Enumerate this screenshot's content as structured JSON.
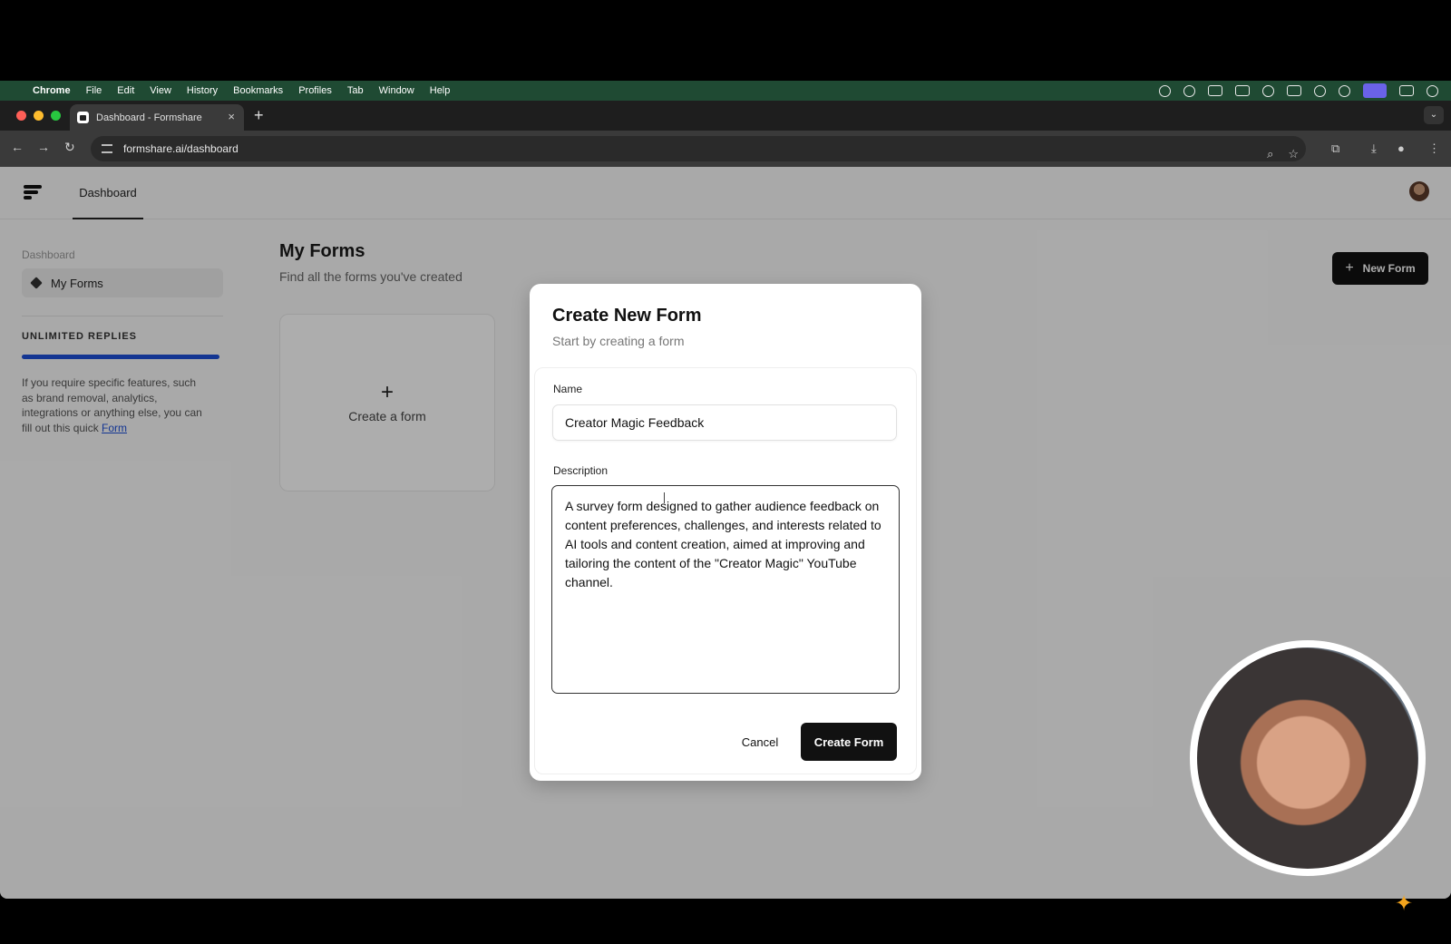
{
  "menubar": {
    "app": "Chrome",
    "items": [
      "File",
      "Edit",
      "View",
      "History",
      "Bookmarks",
      "Profiles",
      "Tab",
      "Window",
      "Help"
    ]
  },
  "browser": {
    "tab_title": "Dashboard - Formshare",
    "url": "formshare.ai/dashboard"
  },
  "header": {
    "nav_tab": "Dashboard"
  },
  "sidebar": {
    "section": "Dashboard",
    "item": "My Forms",
    "plan_label": "UNLIMITED REPLIES",
    "progress": 1.0,
    "help_text": "If you require specific features, such as brand removal, analytics, integrations or anything else, you can fill out this quick ",
    "help_link": "Form"
  },
  "main": {
    "title": "My Forms",
    "subtitle": "Find all the forms you've created",
    "create_card_label": "Create a form",
    "new_form_button": "New Form"
  },
  "modal": {
    "title": "Create New Form",
    "subtitle": "Start by creating a form",
    "name_label": "Name",
    "name_value": "Creator Magic Feedback",
    "description_label": "Description",
    "description_value": "A survey form designed to gather audience feedback on content preferences, challenges, and interests related to AI tools and content creation, aimed at improving and tailoring the content of the \"Creator Magic\" YouTube channel.",
    "cancel_label": "Cancel",
    "submit_label": "Create Form"
  },
  "colors": {
    "accent": "#1d4fd7",
    "button_dark": "#111111",
    "menubar": "#1f4a33"
  }
}
